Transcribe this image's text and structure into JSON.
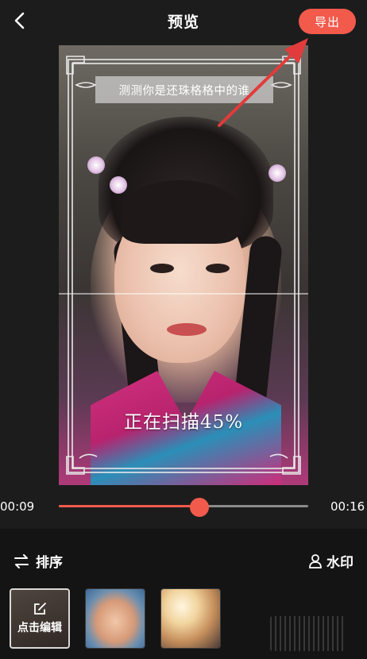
{
  "header": {
    "title": "预览",
    "export_label": "导出"
  },
  "preview": {
    "caption": "测测你是还珠格格中的谁",
    "scan_status": "正在扫描45%",
    "scan_progress": 0.45
  },
  "timeline": {
    "current_time": "00:09",
    "total_time": "00:16",
    "progress": 0.565
  },
  "toolbar": {
    "sort_label": "排序",
    "watermark_label": "水印"
  },
  "clips": {
    "edit_label": "点击编辑"
  },
  "colors": {
    "accent": "#f25a4c",
    "background": "#1c1c1c",
    "panel": "#141414"
  },
  "icons": {
    "back": "chevron-left-icon",
    "sort": "swap-arrows-icon",
    "watermark": "person-icon",
    "edit": "edit-square-icon"
  }
}
